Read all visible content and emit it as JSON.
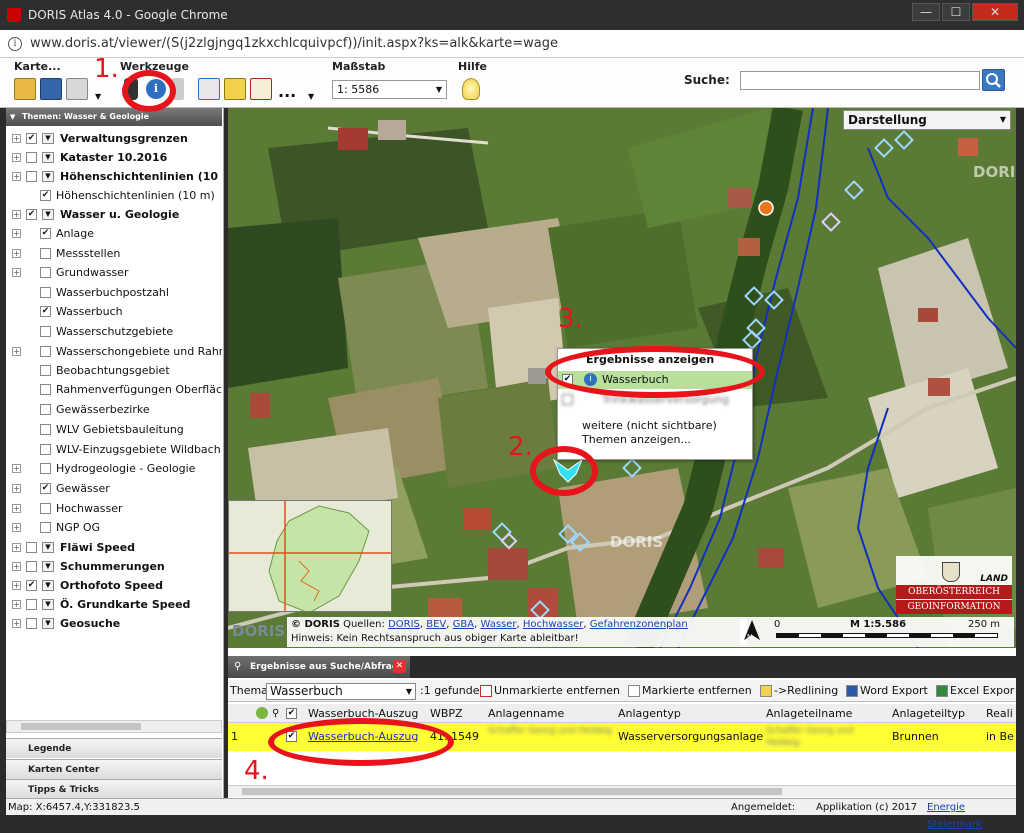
{
  "window": {
    "title": "DORIS Atlas 4.0 - Google Chrome",
    "min": "—",
    "max": "☐",
    "close": "✕"
  },
  "browser": {
    "url": "www.doris.at/viewer/(S(j2zlgjngq1zkxchlcquivpcf))/init.aspx?ks=alk&karte=wage"
  },
  "toolbar": {
    "karte_label": "Karte...",
    "werkzeuge_label": "Werkzeuge",
    "massstab_label": "Maßstab",
    "hilfe_label": "Hilfe",
    "scale_prefix": "1:",
    "scale_value": "5586",
    "search_label": "Suche:",
    "more": "..."
  },
  "annotations": {
    "step1": "1.",
    "step2": "2.",
    "step3": "3.",
    "step4": "4."
  },
  "sidebar": {
    "header": "Themen: Wasser & Geologie",
    "items": [
      {
        "label": "Verwaltungsgrenzen",
        "checked": "✔"
      },
      {
        "label": "Kataster 10.2016",
        "checked": ""
      },
      {
        "label": "Höhenschichtenlinien (10",
        "checked": ""
      },
      {
        "label": "Höhenschichtenlinien (10 m)",
        "checked": "✔"
      },
      {
        "label": "Wasser u. Geologie",
        "checked": "✔"
      },
      {
        "label": "Anlage",
        "checked": "✔"
      },
      {
        "label": "Messstellen",
        "checked": ""
      },
      {
        "label": "Grundwasser",
        "checked": ""
      },
      {
        "label": "Wasserbuchpostzahl",
        "checked": ""
      },
      {
        "label": "Wasserbuch",
        "checked": "✔"
      },
      {
        "label": "Wasserschutzgebiete",
        "checked": ""
      },
      {
        "label": "Wasserschongebiete und Rahr",
        "checked": ""
      },
      {
        "label": "Beobachtungsgebiet",
        "checked": ""
      },
      {
        "label": "Rahmenverfügungen Oberfläc",
        "checked": ""
      },
      {
        "label": "Gewässerbezirke",
        "checked": ""
      },
      {
        "label": "WLV Gebietsbauleitung",
        "checked": ""
      },
      {
        "label": "WLV-Einzugsgebiete Wildbach",
        "checked": ""
      },
      {
        "label": "Hydrogeologie - Geologie",
        "checked": ""
      },
      {
        "label": "Gewässer",
        "checked": "✔"
      },
      {
        "label": "Hochwasser",
        "checked": ""
      },
      {
        "label": "NGP OG",
        "checked": ""
      },
      {
        "label": "Fläwi Speed",
        "checked": ""
      },
      {
        "label": "Schummerungen",
        "checked": ""
      },
      {
        "label": "Orthofoto Speed",
        "checked": "✔"
      },
      {
        "label": "Ö. Grundkarte Speed",
        "checked": ""
      },
      {
        "label": "Geosuche",
        "checked": ""
      }
    ],
    "footer": [
      "Legende",
      "Karten Center",
      "Tipps & Tricks"
    ]
  },
  "map": {
    "darstellung": "Darstellung",
    "watermark": "DORIS",
    "popup": {
      "title": "Ergebnisse anzeigen",
      "item1": "Wasserbuch",
      "item2": "Trinkwasserversorgung",
      "more_line1": "weitere (nicht sichtbare)",
      "more_line2": "Themen anzeigen..."
    },
    "copyright": "© DORIS",
    "sources_label": "Quellen:",
    "sources": [
      "DORIS",
      "BEV",
      "GBA",
      "Wasser",
      "Hochwasser",
      "Gefahrenzonenplan"
    ],
    "hint": "Hinweis: Kein Rechtsanspruch aus obiger Karte ableitbar!",
    "north": "N",
    "scale_zero": "0",
    "scale_ratio": "M 1:5.586",
    "scale_end": "250 m",
    "logo_land": "LAND",
    "logo_ooe": "OBERÖSTERREICH",
    "logo_geo": "GEOINFORMATION"
  },
  "results": {
    "tab": "Ergebnisse aus Suche/Abfrage",
    "thema_label": "Thema:",
    "thema_value": "Wasserbuch",
    "found": ":1 gefunden",
    "buttons": [
      "Unmarkierte entfernen",
      "Markierte entfernen",
      "->Redlining",
      "Word Export",
      "Excel Expor"
    ],
    "columns": [
      "Wasserbuch-Auszug",
      "WBPZ",
      "Anlagenname",
      "Anlagentyp",
      "Anlageteilname",
      "Anlageteiltyp",
      "Reali"
    ],
    "row": {
      "num": "1",
      "auszug": "Wasserbuch-Auszug",
      "wbpz": "41..1549",
      "anlagenname": "Schaffer Georg und Hedwig",
      "anlagentyp": "Wasserversorgungsanlage",
      "teilname": "Schaffer Georg und Hedwig",
      "teiltyp": "Brunnen",
      "reali": "in Be"
    }
  },
  "status": {
    "coords": "Map: X:6457.4,Y:331823.5",
    "login": "Angemeldet:",
    "app": "Applikation (c) 2017",
    "energie": "Energie Steiermark"
  }
}
